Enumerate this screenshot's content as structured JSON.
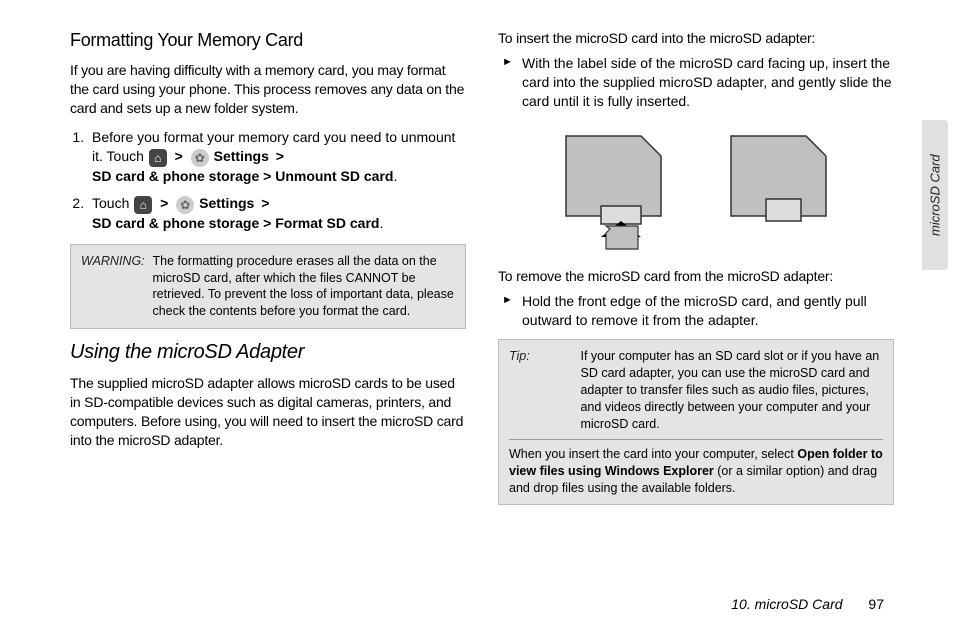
{
  "left": {
    "heading1": "Formatting Your Memory Card",
    "intro": "If you are having difficulty with a memory card, you may format the card using your phone. This process removes any data on the card and sets up a new folder system.",
    "step1_pre": "Before you format your memory card you need to unmount it. Touch ",
    "step1_settings": "Settings",
    "step1_path": "SD card & phone storage > Unmount SD card",
    "step2_pre": "Touch ",
    "step2_settings": "Settings",
    "step2_path": "SD card & phone storage > Format SD card",
    "gt": ">",
    "warning_label": "WARNING:",
    "warning_text": "The formatting procedure erases all the data on the microSD card, after which the files CANNOT be retrieved. To prevent the loss of important data, please check the contents before you format the card.",
    "heading2": "Using the microSD Adapter",
    "adapter_intro": "The supplied microSD adapter allows microSD cards to be used in SD-compatible devices such as digital cameras, printers, and computers. Before using, you will need to insert the microSD card into the microSD adapter."
  },
  "right": {
    "insert_lead": "To insert the microSD card into the microSD adapter:",
    "insert_step": "With the label side of the microSD card facing up, insert the card into the supplied microSD adapter, and gently slide the card until it is fully inserted.",
    "remove_lead": "To remove the microSD card from the microSD adapter:",
    "remove_step": "Hold the front edge of the microSD card, and gently pull outward to remove it from the adapter.",
    "tip_label": "Tip:",
    "tip_text1": "If your computer has an SD card slot or if you have an SD card adapter, you can use the microSD card and adapter to transfer files such as audio files, pictures, and videos directly between your computer and your microSD card.",
    "tip_text2_pre": "When you insert the card into your computer, select ",
    "tip_text2_bold": "Open folder to view files using Windows Explorer",
    "tip_text2_post": " (or a similar option) and drag and drop files using the available folders."
  },
  "side_tab": "microSD Card",
  "footer_chapter": "10. microSD Card",
  "footer_page": "97",
  "icons": {
    "home": "⌂",
    "gear": "✿"
  },
  "period": "."
}
